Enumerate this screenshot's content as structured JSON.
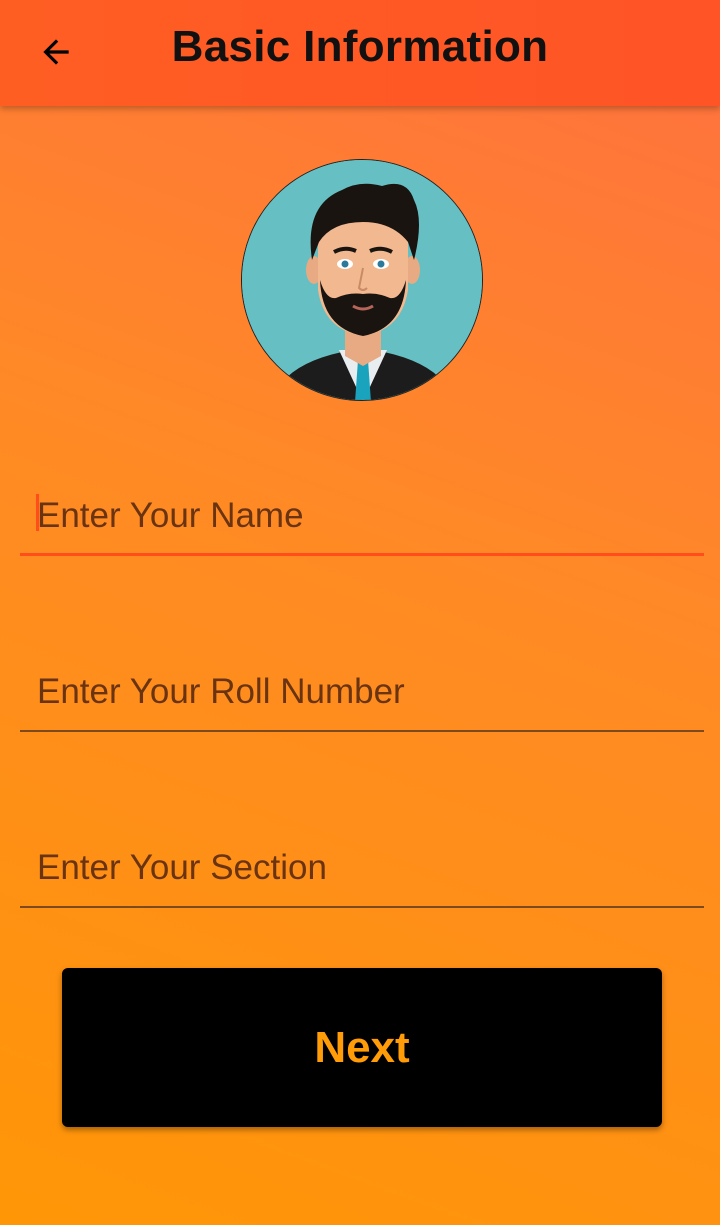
{
  "app_bar": {
    "title": "Basic Information",
    "back_icon": "arrow-left-icon"
  },
  "avatar": {
    "icon": "man-with-beard-avatar"
  },
  "form": {
    "name_field": {
      "value": "",
      "placeholder": "Enter Your Name",
      "focused": true
    },
    "roll_field": {
      "value": "",
      "placeholder": "Enter Your Roll Number"
    },
    "section_field": {
      "value": "",
      "placeholder": "Enter Your Section"
    }
  },
  "next_button": {
    "label": "Next"
  },
  "colors": {
    "app_bar": "#ff5426",
    "accent": "#ff4e1c",
    "button_bg": "#000000",
    "button_text": "#ff9c08"
  }
}
